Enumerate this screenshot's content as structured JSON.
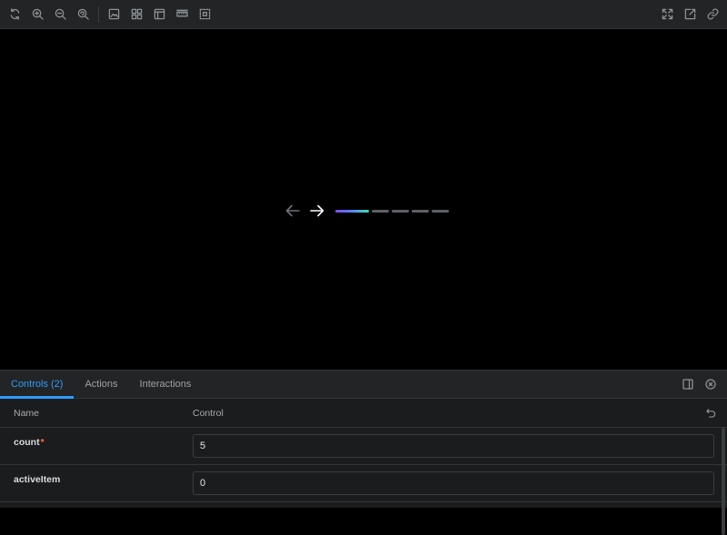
{
  "toolbar": {
    "left_icons": [
      "reload-icon",
      "zoom-in-icon",
      "zoom-out-icon",
      "zoom-reset-icon",
      "background-icon",
      "grid-icon",
      "viewport-icon",
      "measure-icon",
      "outline-icon"
    ],
    "right_icons": [
      "fullscreen-icon",
      "open-new-tab-icon",
      "copy-link-icon"
    ]
  },
  "carousel": {
    "prev_icon": "arrow-left-icon",
    "next_icon": "arrow-right-icon",
    "dot_count": 5,
    "active_index": 0,
    "colors": {
      "active_start": "#7b4dff",
      "active_end": "#3de3b0",
      "inactive": "#5d6166"
    }
  },
  "panel": {
    "tabs": [
      {
        "label": "Controls (2)",
        "active": true
      },
      {
        "label": "Actions",
        "active": false
      },
      {
        "label": "Interactions",
        "active": false
      }
    ],
    "accent": "#2f9cff",
    "columns": {
      "name": "Name",
      "control": "Control"
    },
    "rows": [
      {
        "name": "count",
        "required": true,
        "required_mark": "*",
        "value": "5"
      },
      {
        "name": "activeItem",
        "required": false,
        "value": "0"
      }
    ]
  }
}
